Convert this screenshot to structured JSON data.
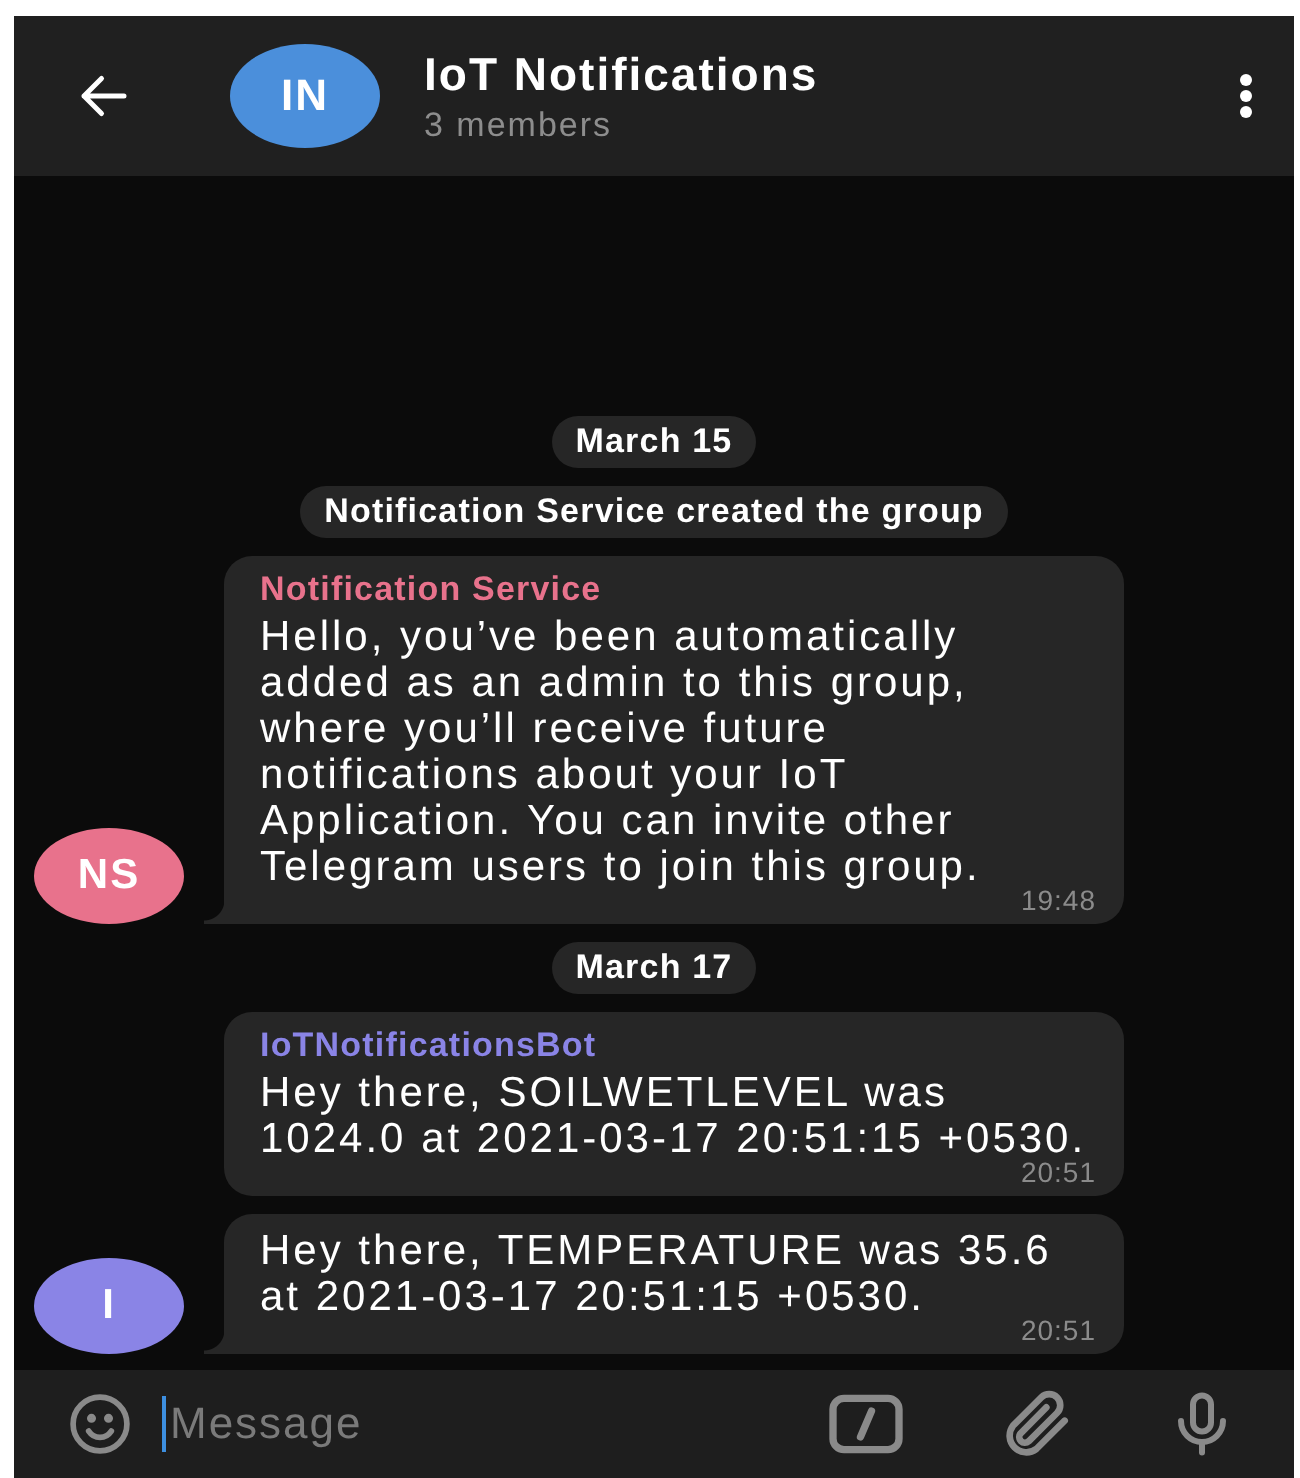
{
  "header": {
    "avatar": {
      "initials": "IN",
      "color": "#4b8fdb"
    },
    "title": "IoT Notifications",
    "subtitle": "3 members"
  },
  "items": [
    {
      "kind": "date",
      "text": "March 15"
    },
    {
      "kind": "service",
      "text": "Notification Service created the group"
    },
    {
      "kind": "message",
      "sender": "Notification Service",
      "color": "#e8728c",
      "avatar": "NS",
      "text": "Hello, you’ve been automatically added as an admin to this group, where you’ll receive future notifications about your IoT Application. You can invite other Telegram users to join this group.",
      "time": "19:48"
    },
    {
      "kind": "date",
      "text": "March 17"
    },
    {
      "kind": "message",
      "sender": "IoTNotificationsBot",
      "color": "#8a84e6",
      "text": "Hey there, SOILWETLEVEL was 1024.0 at 2021-03-17 20:51:15 +0530.",
      "time": "20:51"
    },
    {
      "kind": "message",
      "color": "#8a84e6",
      "avatar": "I",
      "text": "Hey there, TEMPERATURE was 35.6 at 2021-03-17 20:51:15 +0530.",
      "time": "20:51"
    }
  ],
  "composer": {
    "placeholder": "Message"
  }
}
